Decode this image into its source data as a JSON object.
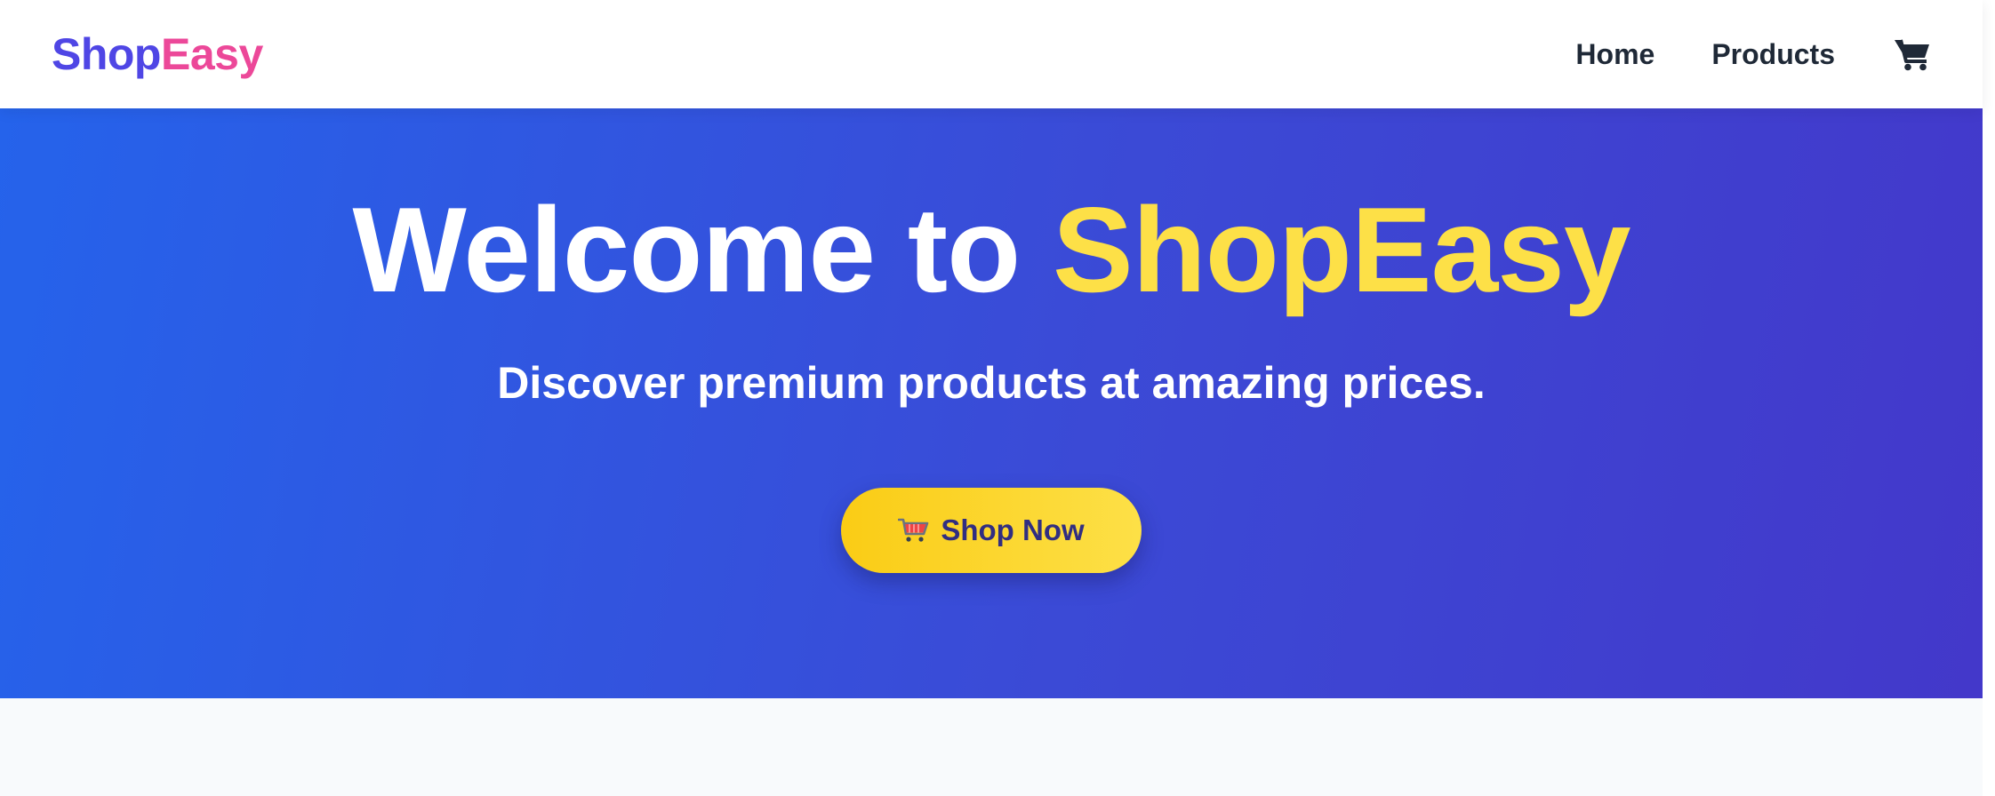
{
  "navbar": {
    "logo_part1": "Shop",
    "logo_part2": "Easy",
    "links": [
      {
        "label": "Home"
      },
      {
        "label": "Products"
      }
    ],
    "cart_icon": "shopping-cart-icon"
  },
  "hero": {
    "title_prefix": "Welcome to ",
    "title_highlight": "ShopEasy",
    "subtitle": "Discover premium products at amazing prices.",
    "cta_icon": "shopping-cart-emoji",
    "cta_label": "Shop Now"
  },
  "colors": {
    "logo_primary": "#4f46e5",
    "logo_accent": "#ec4899",
    "hero_gradient_start": "#2563eb",
    "hero_gradient_end": "#4338ca",
    "highlight": "#fde047",
    "cta_background": "#facc15",
    "cta_text": "#312e81",
    "nav_text": "#1f2937",
    "page_background": "#f8fafc"
  }
}
